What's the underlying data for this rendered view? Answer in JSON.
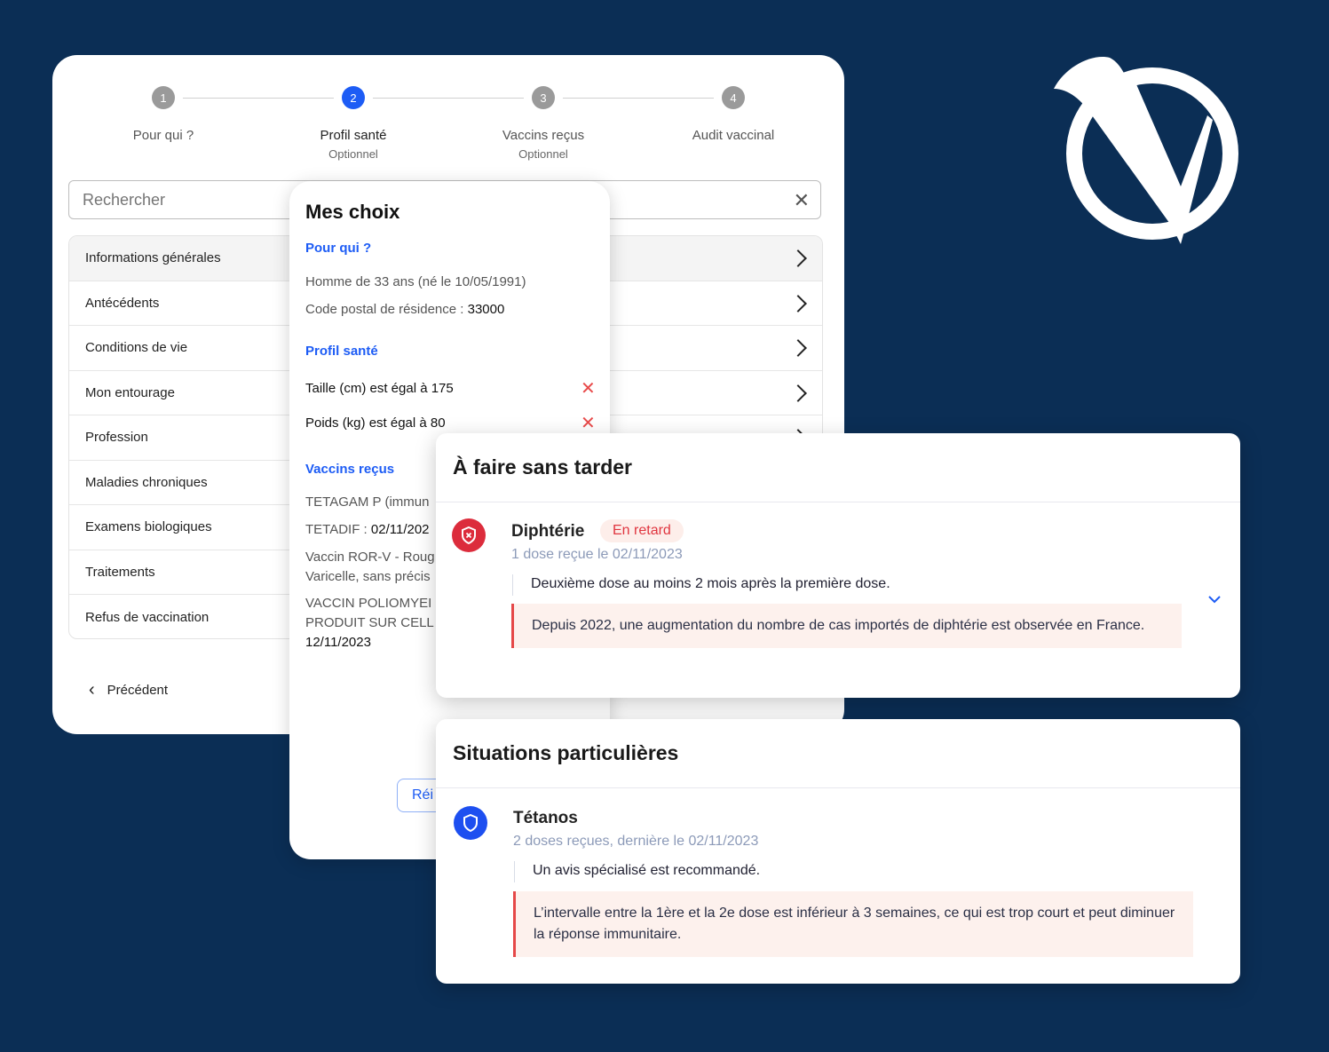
{
  "stepper": {
    "steps": [
      {
        "number": "1",
        "label": "Pour qui ?",
        "sub": ""
      },
      {
        "number": "2",
        "label": "Profil santé",
        "sub": "Optionnel"
      },
      {
        "number": "3",
        "label": "Vaccins reçus",
        "sub": "Optionnel"
      },
      {
        "number": "4",
        "label": "Audit vaccinal",
        "sub": ""
      }
    ],
    "active_step": 2,
    "active_color": "#1d5cf5"
  },
  "search": {
    "placeholder": "Rechercher"
  },
  "categories": [
    "Informations générales",
    "Antécédents",
    "Conditions de vie",
    "Mon entourage",
    "Profession",
    "Maladies chroniques",
    "Examens biologiques",
    "Traitements",
    "Refus de vaccination"
  ],
  "nav": {
    "previous": "Précédent"
  },
  "choices": {
    "title": "Mes choix",
    "pour_qui": {
      "heading": "Pour qui ?",
      "person": "Homme de 33 ans (né le 10/05/1991)",
      "postal_label": "Code postal de résidence : ",
      "postal_value": "33000"
    },
    "profil": {
      "heading": "Profil santé",
      "items": [
        "Taille (cm) est égal à 175",
        "Poids (kg) est égal à 80"
      ]
    },
    "vaccins": {
      "heading": "Vaccins reçus",
      "v1": "TETAGAM P (immun",
      "v2_label": "TETADIF : ",
      "v2_value": "02/11/202",
      "v3_line1": "Vaccin ROR-V - Roug",
      "v3_line2": "Varicelle, sans précis",
      "v4_line1": "VACCIN POLIOMYEI",
      "v4_line2": "PRODUIT SUR CELL",
      "v4_date": "12/11/2023"
    },
    "reset_label": "Réi"
  },
  "urgent": {
    "title": "À faire sans tarder",
    "disease": "Diphtérie",
    "badge": "En retard",
    "doses": "1 dose reçue le 02/11/2023",
    "note": "Deuxième dose au moins 2 mois après la première dose.",
    "alert": "Depuis 2022, une augmentation du nombre de cas importés de diphtérie est observée en France.",
    "icon_color": "#dc2c3c"
  },
  "special": {
    "title": "Situations particulières",
    "disease": "Tétanos",
    "doses": "2 doses reçues, dernière le 02/11/2023",
    "note": "Un avis spécialisé est recommandé.",
    "alert": "L’intervalle entre la 1ère et la 2e dose est inférieur à 3 semaines, ce qui est trop court et peut diminuer la réponse immunitaire.",
    "icon_color": "#1d4ff0"
  },
  "colors": {
    "background": "#0b2e55",
    "accent": "#1d5cf5",
    "alert": "#e54848"
  }
}
